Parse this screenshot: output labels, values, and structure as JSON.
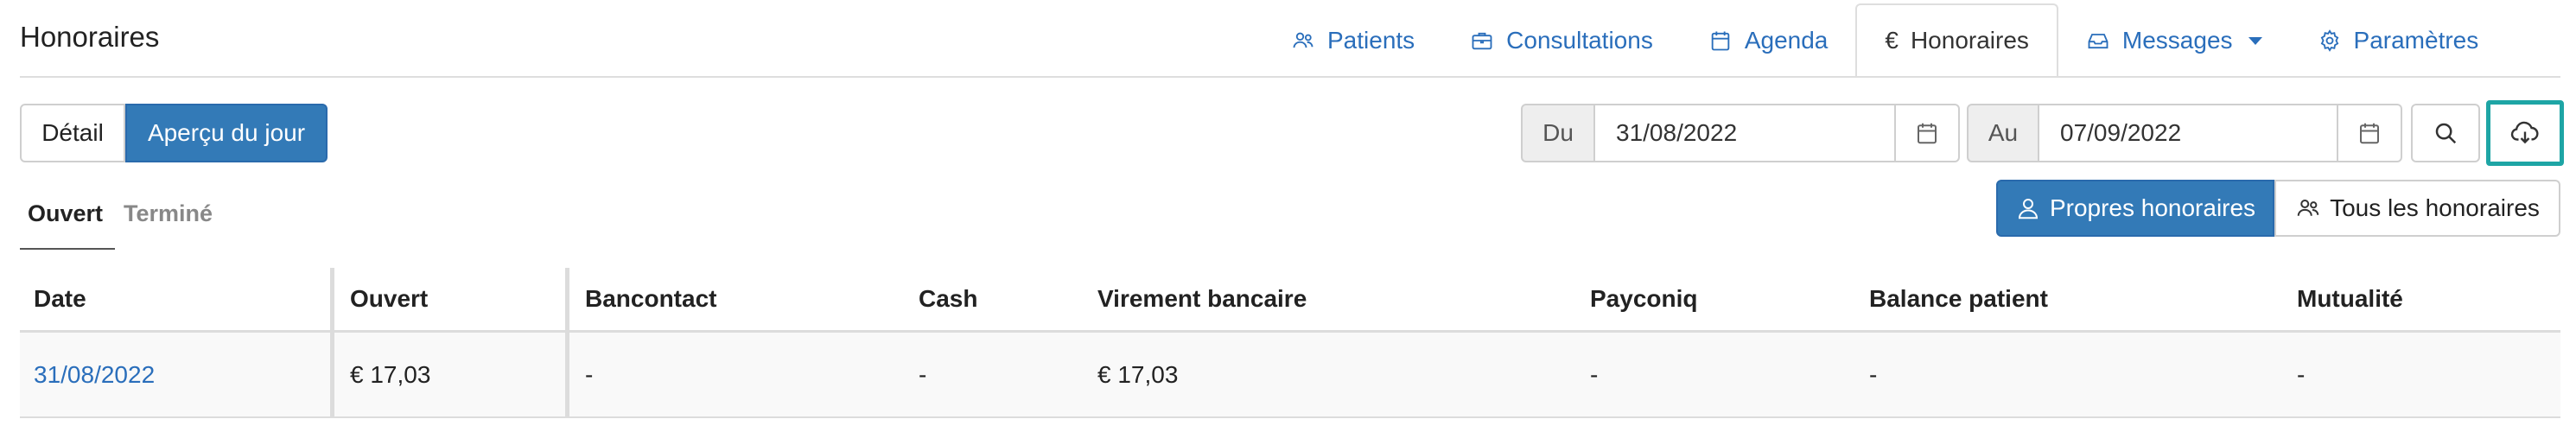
{
  "page": {
    "title": "Honoraires"
  },
  "nav": {
    "tabs": [
      {
        "id": "patients",
        "label": "Patients",
        "icon": "users-icon"
      },
      {
        "id": "consultations",
        "label": "Consultations",
        "icon": "briefcase-icon"
      },
      {
        "id": "agenda",
        "label": "Agenda",
        "icon": "calendar-icon"
      },
      {
        "id": "honoraires",
        "label": "Honoraires",
        "icon": "euro-icon",
        "active": true
      },
      {
        "id": "messages",
        "label": "Messages",
        "icon": "inbox-icon",
        "dropdown": true
      },
      {
        "id": "parametres",
        "label": "Paramètres",
        "icon": "gear-icon"
      }
    ]
  },
  "view_toggle": {
    "detail": "Détail",
    "apercu": "Aperçu du jour",
    "selected": "apercu"
  },
  "date_range": {
    "from_label": "Du",
    "from_value": "31/08/2022",
    "to_label": "Au",
    "to_value": "07/09/2022"
  },
  "status_tabs": {
    "open": "Ouvert",
    "done": "Terminé",
    "selected": "open"
  },
  "filter": {
    "own": "Propres honoraires",
    "all": "Tous les honoraires",
    "selected": "own"
  },
  "table": {
    "headers": [
      "Date",
      "Ouvert",
      "Bancontact",
      "Cash",
      "Virement bancaire",
      "Payconiq",
      "Balance patient",
      "Mutualité"
    ],
    "rows": [
      [
        "31/08/2022",
        "€ 17,03",
        "-",
        "-",
        "€ 17,03",
        "-",
        "-",
        "-"
      ]
    ]
  },
  "colors": {
    "accent": "#337ab7",
    "link": "#2a6ebb",
    "highlight": "#1ea5a5"
  }
}
